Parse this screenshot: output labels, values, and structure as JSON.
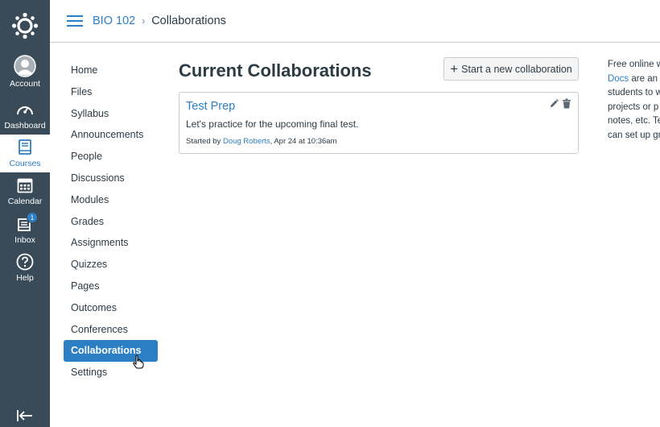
{
  "global_nav": {
    "items": [
      {
        "label": "Account",
        "icon": "avatar-icon"
      },
      {
        "label": "Dashboard",
        "icon": "dashboard-icon"
      },
      {
        "label": "Courses",
        "icon": "book-icon",
        "active": true
      },
      {
        "label": "Calendar",
        "icon": "calendar-icon"
      },
      {
        "label": "Inbox",
        "icon": "inbox-icon",
        "badge": "1"
      },
      {
        "label": "Help",
        "icon": "help-icon"
      }
    ]
  },
  "header": {
    "course_link": "BIO 102",
    "separator": "›",
    "current_page": "Collaborations"
  },
  "course_nav": {
    "items": [
      "Home",
      "Files",
      "Syllabus",
      "Announcements",
      "People",
      "Discussions",
      "Modules",
      "Grades",
      "Assignments",
      "Quizzes",
      "Pages",
      "Outcomes",
      "Conferences",
      "Collaborations",
      "Settings"
    ],
    "active_index": 13
  },
  "main": {
    "title": "Current Collaborations",
    "new_button_label": "Start a new collaboration",
    "new_button_plus": "+",
    "collaborations": [
      {
        "title": "Test Prep",
        "description": "Let's practice for the upcoming final test.",
        "started_by_prefix": "Started by ",
        "author": "Doug Roberts",
        "date_suffix": ", Apr 24 at 10:36am"
      }
    ]
  },
  "aside": {
    "line1": "Free online w",
    "line2_link": "Docs",
    "line2_rest": " are an c",
    "line3": "students to w",
    "line4": "projects or p",
    "line5": "notes, etc. Te",
    "line6": "can set up gr"
  },
  "colors": {
    "nav_bg": "#394b58",
    "accent": "#2d7fc4",
    "text": "#2d3b45",
    "border": "#c7cdd1"
  }
}
